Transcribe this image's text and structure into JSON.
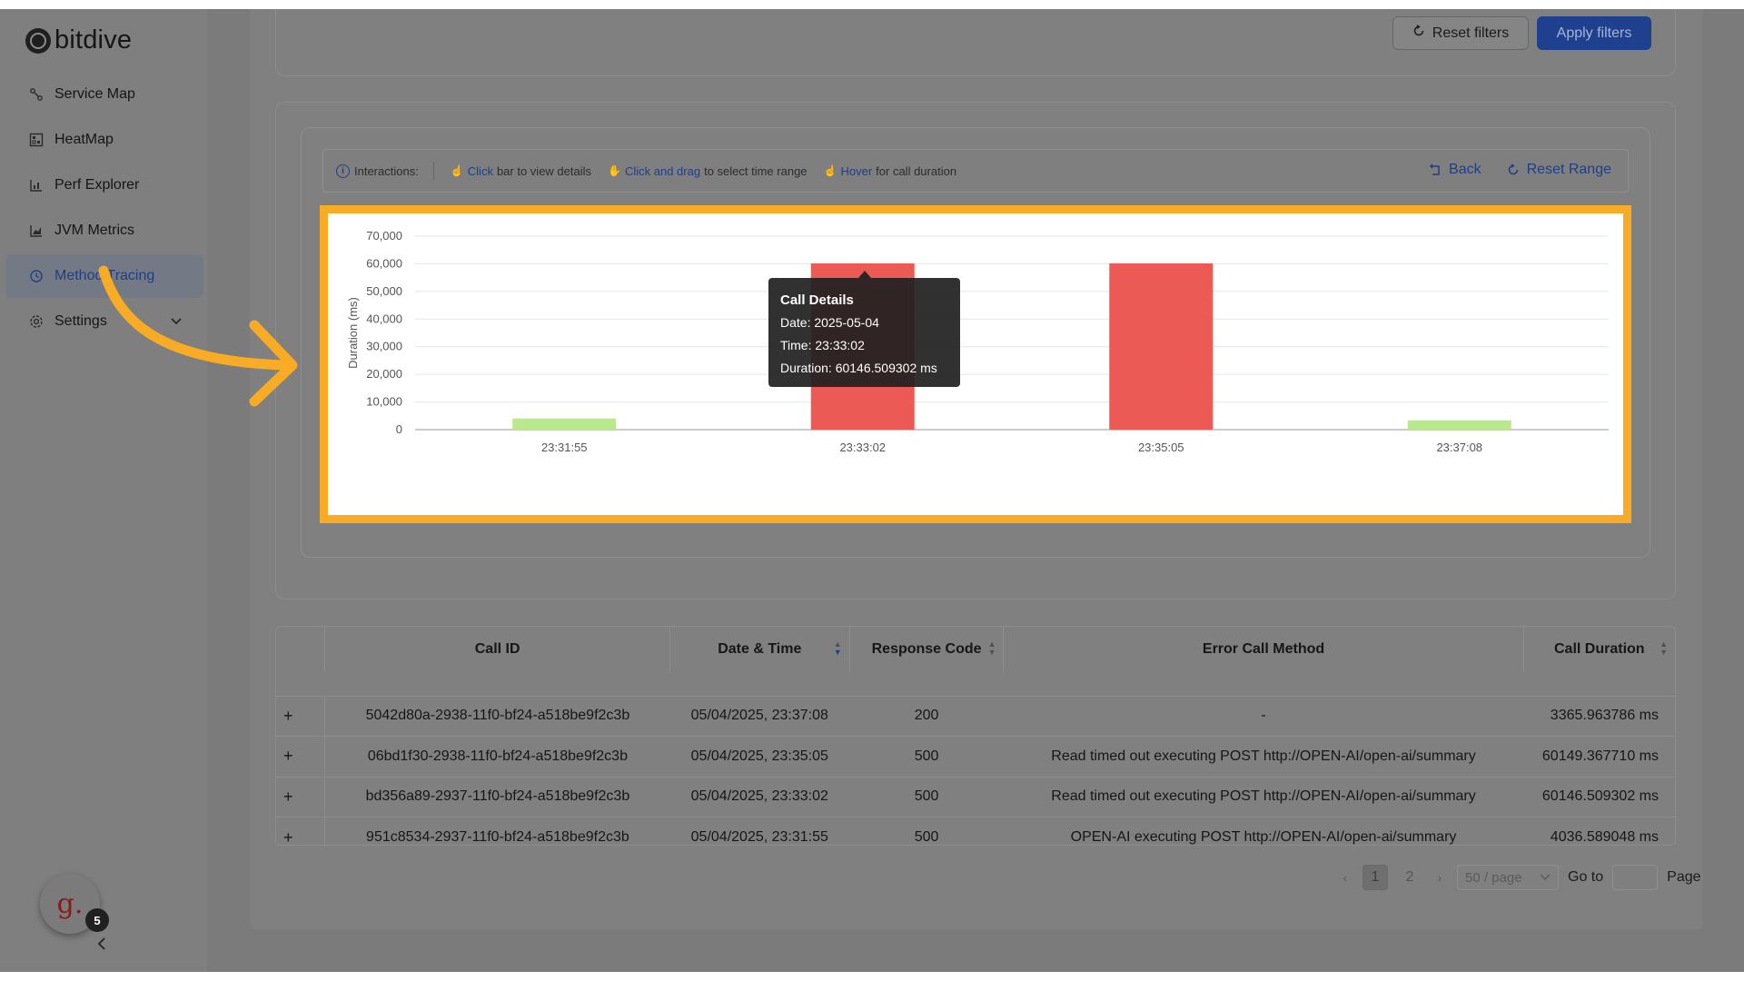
{
  "app": {
    "name": "bitdive"
  },
  "sidebar": {
    "items": [
      {
        "label": "Service Map",
        "icon": "service-map-icon"
      },
      {
        "label": "HeatMap",
        "icon": "heatmap-icon"
      },
      {
        "label": "Perf Explorer",
        "icon": "perf-explorer-icon"
      },
      {
        "label": "JVM Metrics",
        "icon": "jvm-metrics-icon"
      },
      {
        "label": "Method Tracing",
        "icon": "method-tracing-icon",
        "active": true
      },
      {
        "label": "Settings",
        "icon": "settings-icon"
      }
    ],
    "avatar_letter": "g.",
    "notification_count": "5"
  },
  "filters": {
    "reset_label": "Reset filters",
    "apply_label": "Apply filters"
  },
  "interactions": {
    "label": "Interactions:",
    "hint1_action": "Click",
    "hint1_text": "bar to view details",
    "hint2_action": "Click and drag",
    "hint2_text": "to select time range",
    "hint3_action": "Hover",
    "hint3_text": "for call duration",
    "back_label": "Back",
    "reset_range_label": "Reset Range"
  },
  "chart_data": {
    "type": "bar",
    "ylabel": "Duration (ms)",
    "xlabel": "",
    "ylim": [
      0,
      70000
    ],
    "yticks": [
      0,
      10000,
      20000,
      30000,
      40000,
      50000,
      60000,
      70000
    ],
    "ytick_labels": [
      "0",
      "10,000",
      "20,000",
      "30,000",
      "40,000",
      "50,000",
      "60,000",
      "70,000"
    ],
    "categories": [
      "23:31:55",
      "23:33:02",
      "23:35:05",
      "23:37:08"
    ],
    "values": [
      4036.589048,
      60146.509302,
      60149.36771,
      3365.963786
    ],
    "status": [
      "error",
      "error",
      "error",
      "ok"
    ],
    "colors": {
      "error": "#ec5a56",
      "ok": "#b9e98a",
      "error_low": "#b9e98a"
    },
    "bar_colors": [
      "#b9e98a",
      "#ec5a56",
      "#ec5a56",
      "#b9e98a"
    ],
    "grid": true,
    "tooltip": {
      "title": "Call Details",
      "date": "Date: 2025-05-04",
      "time": "Time: 23:33:02",
      "duration": "Duration: 60146.509302 ms"
    }
  },
  "table": {
    "columns": [
      "Call ID",
      "Date & Time",
      "Response Code",
      "Error Call Method",
      "Call Duration"
    ],
    "rows": [
      {
        "expand": "+",
        "call_id": "5042d80a-2938-11f0-bf24-a518be9f2c3b",
        "date_time": "05/04/2025, 23:37:08",
        "code": "200",
        "method": "-",
        "duration": "3365.963786 ms"
      },
      {
        "expand": "+",
        "call_id": "06bd1f30-2938-11f0-bf24-a518be9f2c3b",
        "date_time": "05/04/2025, 23:35:05",
        "code": "500",
        "method": "Read timed out executing POST http://OPEN-AI/open-ai/summary",
        "duration": "60149.367710 ms"
      },
      {
        "expand": "+",
        "call_id": "bd356a89-2937-11f0-bf24-a518be9f2c3b",
        "date_time": "05/04/2025, 23:33:02",
        "code": "500",
        "method": "Read timed out executing POST http://OPEN-AI/open-ai/summary",
        "duration": "60146.509302 ms"
      },
      {
        "expand": "+",
        "call_id": "951c8534-2937-11f0-bf24-a518be9f2c3b",
        "date_time": "05/04/2025, 23:31:55",
        "code": "500",
        "method": "OPEN-AI executing POST http://OPEN-AI/open-ai/summary",
        "duration": "4036.589048 ms"
      }
    ]
  },
  "pagination": {
    "pages": [
      "1",
      "2"
    ],
    "current": "1",
    "page_size": "50 / page",
    "goto_label": "Go to",
    "page_label": "Page"
  },
  "colors": {
    "accent": "#f8ac26",
    "primary": "#1e3f86"
  }
}
